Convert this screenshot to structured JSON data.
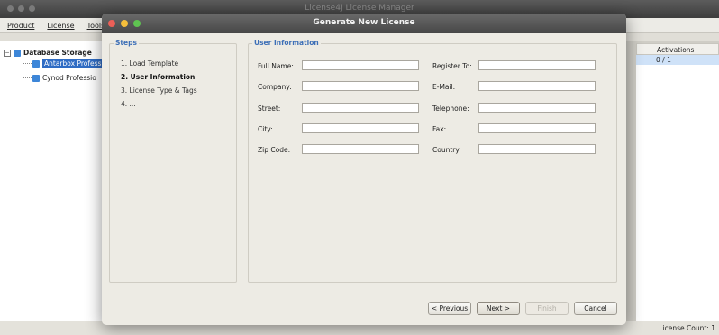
{
  "background_app": {
    "window_title": "License4J License Manager",
    "menu": [
      "Product",
      "License",
      "Tools"
    ],
    "tree": {
      "root_label": "Database Storage",
      "children": [
        "Antarbox Profess",
        "Cynod Professio"
      ]
    },
    "table": {
      "column_header": "Activations",
      "row_value": "0 / 1"
    },
    "status_text": "License Count: 1"
  },
  "dialog": {
    "title": "Generate New License",
    "steps_legend": "Steps",
    "steps": [
      "1. Load Template",
      "2. User Information",
      "3. License Type & Tags",
      "4. ..."
    ],
    "current_step_index": 1,
    "user_info_legend": "User Information",
    "fields_left": [
      {
        "label": "Full Name:",
        "value": ""
      },
      {
        "label": "Company:",
        "value": ""
      },
      {
        "label": "Street:",
        "value": ""
      },
      {
        "label": "City:",
        "value": ""
      },
      {
        "label": "Zip Code:",
        "value": ""
      }
    ],
    "fields_right": [
      {
        "label": "Register To:",
        "value": ""
      },
      {
        "label": "E-Mail:",
        "value": ""
      },
      {
        "label": "Telephone:",
        "value": ""
      },
      {
        "label": "Fax:",
        "value": ""
      },
      {
        "label": "Country:",
        "value": ""
      }
    ],
    "buttons": {
      "previous": "< Previous",
      "next": "Next >",
      "finish": "Finish",
      "cancel": "Cancel"
    }
  },
  "colors": {
    "accent_blue": "#3d6fb7",
    "selection": "#2f6cc4",
    "traffic_red": "#ec5f57",
    "traffic_yellow": "#f6bf3b",
    "traffic_green": "#5fc451"
  }
}
